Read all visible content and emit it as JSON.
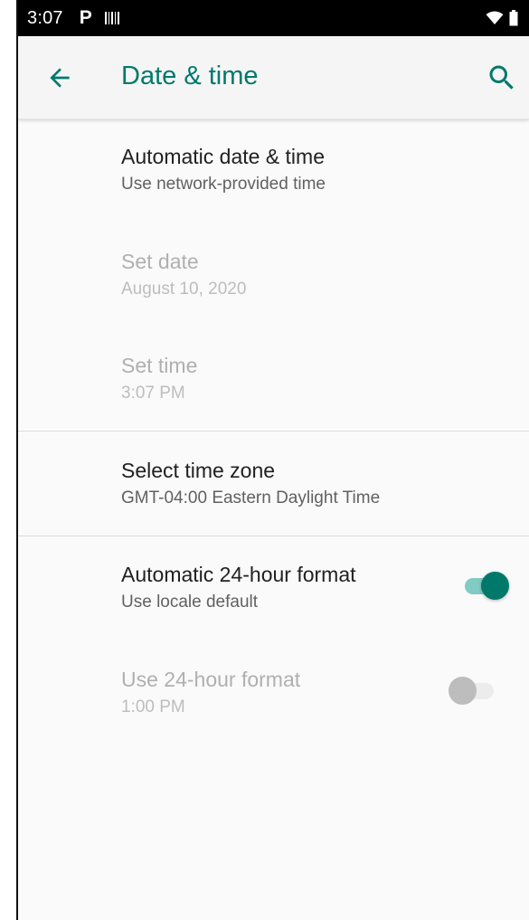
{
  "status_bar": {
    "time": "3:07",
    "p_letter": "P",
    "icons": [
      "p-icon",
      "barcode-icon",
      "wifi-icon",
      "battery-icon"
    ]
  },
  "app_bar": {
    "title": "Date & time",
    "back_icon": "arrow-back-icon",
    "search_icon": "search-icon",
    "accent_color": "#00796b"
  },
  "settings": [
    {
      "title": "Automatic date & time",
      "summary": "Use network-provided time",
      "enabled": true
    },
    {
      "title": "Set date",
      "summary": "August 10, 2020",
      "enabled": false
    },
    {
      "title": "Set time",
      "summary": "3:07 PM",
      "enabled": false
    },
    {
      "title": "Select time zone",
      "summary": "GMT-04:00 Eastern Daylight Time",
      "enabled": true
    },
    {
      "title": "Automatic 24-hour format",
      "summary": "Use locale default",
      "enabled": true,
      "toggle": "on"
    },
    {
      "title": "Use 24-hour format",
      "summary": "1:00 PM",
      "enabled": false,
      "toggle": "off"
    }
  ]
}
